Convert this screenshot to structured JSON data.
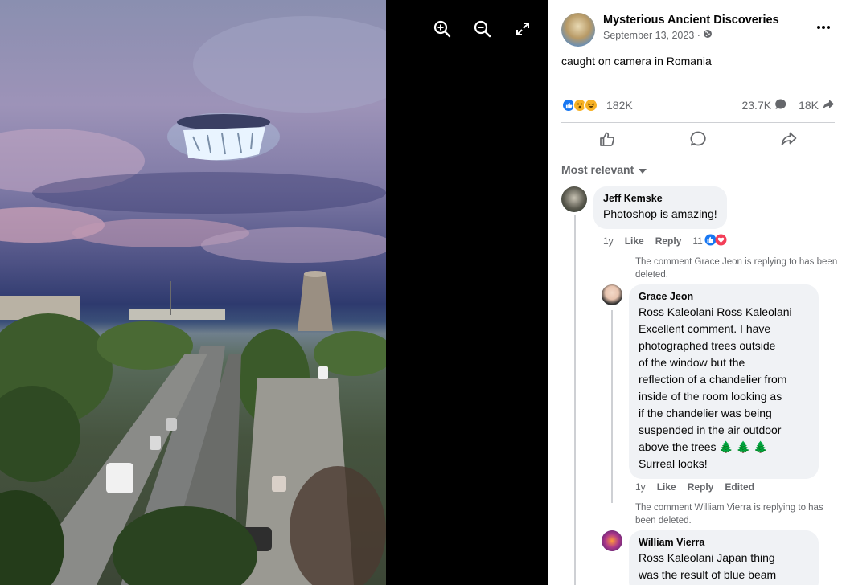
{
  "viewer": {
    "tools": [
      {
        "icon": "zoom-in-icon"
      },
      {
        "icon": "zoom-out-icon"
      },
      {
        "icon": "expand-icon"
      }
    ]
  },
  "post": {
    "page_name": "Mysterious Ancient Discoveries",
    "date": "September 13, 2023 ·",
    "privacy_icon": "globe-icon",
    "caption": "caught on camera in Romania",
    "reactions_count": "182K",
    "comments_count": "23.7K",
    "shares_count": "18K",
    "colors": {
      "like": "#1877f2",
      "love": "#f33e58",
      "haha": "#f7b125",
      "muted": "#65676b"
    }
  },
  "actions": [
    {
      "icon": "like-icon"
    },
    {
      "icon": "comment-icon"
    },
    {
      "icon": "share-icon"
    }
  ],
  "sort_label": "Most relevant",
  "comments": [
    {
      "name": "Jeff Kemske",
      "text": "Photoshop is amazing!",
      "age": "1y",
      "like": "Like",
      "reply": "Reply",
      "reaction_count": "11"
    }
  ],
  "notes": [
    "The comment Grace Jeon is replying to has been deleted.",
    "The comment William Vierra is replying to has been deleted."
  ],
  "replies": [
    {
      "name": "Grace Jeon",
      "lines": [
        "Ross Kaleolani Ross Kaleolani",
        "Excellent comment. I have",
        "photographed trees outside",
        "of the window but the",
        "reflection of a chandelier from",
        "inside of the room looking as",
        "if the chandelier was being",
        "suspended in the air outdoor",
        "above the trees 🌲 🌲 🌲",
        "Surreal looks!"
      ],
      "age": "1y",
      "like": "Like",
      "reply": "Reply",
      "edited": "Edited"
    },
    {
      "name": "William Vierra",
      "lines": [
        "Ross Kaleolani Japan thing",
        "was the result of blue beam"
      ]
    }
  ]
}
